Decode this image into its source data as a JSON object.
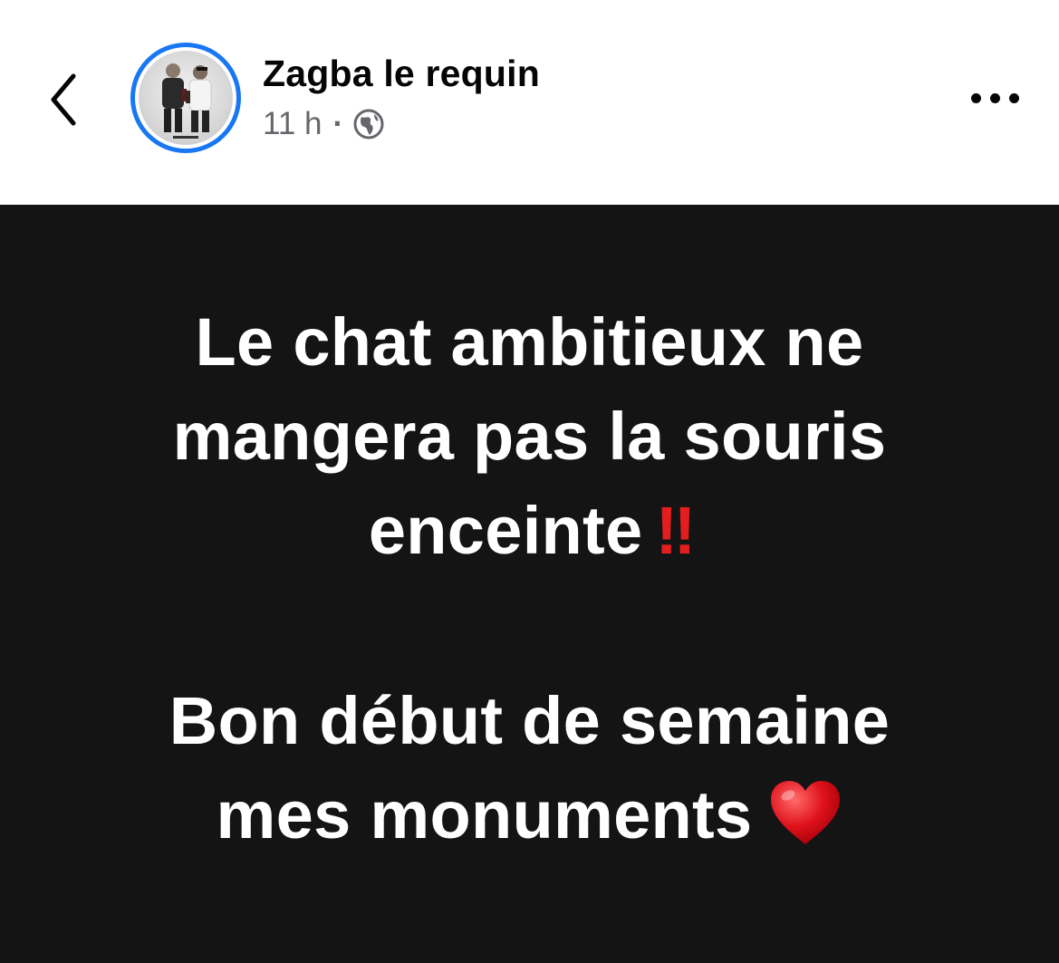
{
  "header": {
    "author_name": "Zagba le requin",
    "timestamp": "11 h",
    "separator": "·",
    "privacy_icon": "globe-icon",
    "back_icon": "chevron-left-icon",
    "more_icon": "more-horizontal-icon",
    "avatar_ring_color": "#1877f2"
  },
  "post": {
    "background_color": "#141414",
    "text_color": "#ffffff",
    "paragraph1": {
      "line1": "Le chat ambitieux ne",
      "line2": "mangera pas la souris",
      "line3": "enceinte",
      "emoji": "‼"
    },
    "paragraph2": {
      "line1": "Bon début de semaine",
      "line2": "mes monuments",
      "emoji": "heart"
    }
  }
}
